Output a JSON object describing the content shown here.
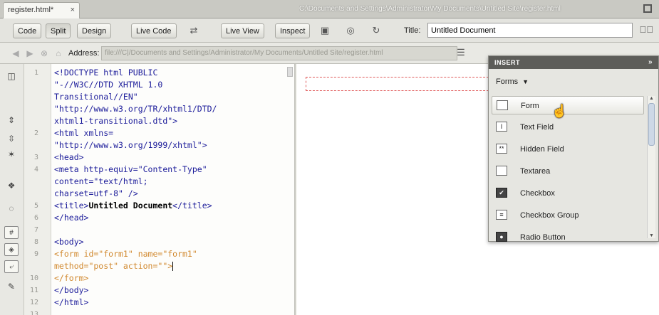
{
  "tab": {
    "label": "register.html*",
    "close": "×"
  },
  "window_path": "C:\\Documents and Settings\\Administrator\\My Documents\\Untitled Site\\register.html",
  "toolbar": {
    "code": "Code",
    "split": "Split",
    "design": "Design",
    "live_code": "Live Code",
    "live_view": "Live View",
    "inspect": "Inspect",
    "title_label": "Title:",
    "title_value": "Untitled Document"
  },
  "address": {
    "label": "Address:",
    "value": "file:///C|/Documents and Settings/Administrator/My Documents/Untitled Site/register.html"
  },
  "code_lines": [
    {
      "num": "1",
      "text": "<!DOCTYPE html PUBLIC"
    },
    {
      "num": "",
      "text": "\"-//W3C//DTD XHTML 1.0"
    },
    {
      "num": "",
      "text": "Transitional//EN\""
    },
    {
      "num": "",
      "text": "\"http://www.w3.org/TR/xhtml1/DTD/"
    },
    {
      "num": "",
      "text": "xhtml1-transitional.dtd\">"
    },
    {
      "num": "2",
      "text": "<html xmlns="
    },
    {
      "num": "",
      "text": "\"http://www.w3.org/1999/xhtml\">"
    },
    {
      "num": "3",
      "text": "<head>"
    },
    {
      "num": "4",
      "text": "<meta http-equiv=\"Content-Type\""
    },
    {
      "num": "",
      "text": "content=\"text/html;"
    },
    {
      "num": "",
      "text": "charset=utf-8\" />"
    },
    {
      "num": "5",
      "text_before": "<title>",
      "bold": "Untitled Document",
      "text_after": "</title>"
    },
    {
      "num": "6",
      "text": "</head>"
    },
    {
      "num": "7",
      "text": ""
    },
    {
      "num": "8",
      "text": "<body>"
    },
    {
      "num": "9",
      "text": "<form id=\"form1\" name=\"form1\"",
      "kind": "form"
    },
    {
      "num": "",
      "text": "method=\"post\" action=\"\">",
      "kind": "form",
      "cursor": true
    },
    {
      "num": "10",
      "text": "</form>",
      "kind": "form"
    },
    {
      "num": "11",
      "text": "</body>"
    },
    {
      "num": "12",
      "text": "</html>"
    },
    {
      "num": "13",
      "text": ""
    }
  ],
  "insert_panel": {
    "title": "INSERT",
    "category": "Forms",
    "items": [
      {
        "label": "Form",
        "icon": "form-icon",
        "glyph": ""
      },
      {
        "label": "Text Field",
        "icon": "text-field-icon",
        "glyph": "I"
      },
      {
        "label": "Hidden Field",
        "icon": "hidden-field-icon",
        "glyph": "**"
      },
      {
        "label": "Textarea",
        "icon": "textarea-icon",
        "glyph": ""
      },
      {
        "label": "Checkbox",
        "icon": "checkbox-icon",
        "glyph": "✔"
      },
      {
        "label": "Checkbox Group",
        "icon": "checkbox-group-icon",
        "glyph": "≡"
      },
      {
        "label": "Radio Button",
        "icon": "radio-button-icon",
        "glyph": "●"
      }
    ]
  }
}
